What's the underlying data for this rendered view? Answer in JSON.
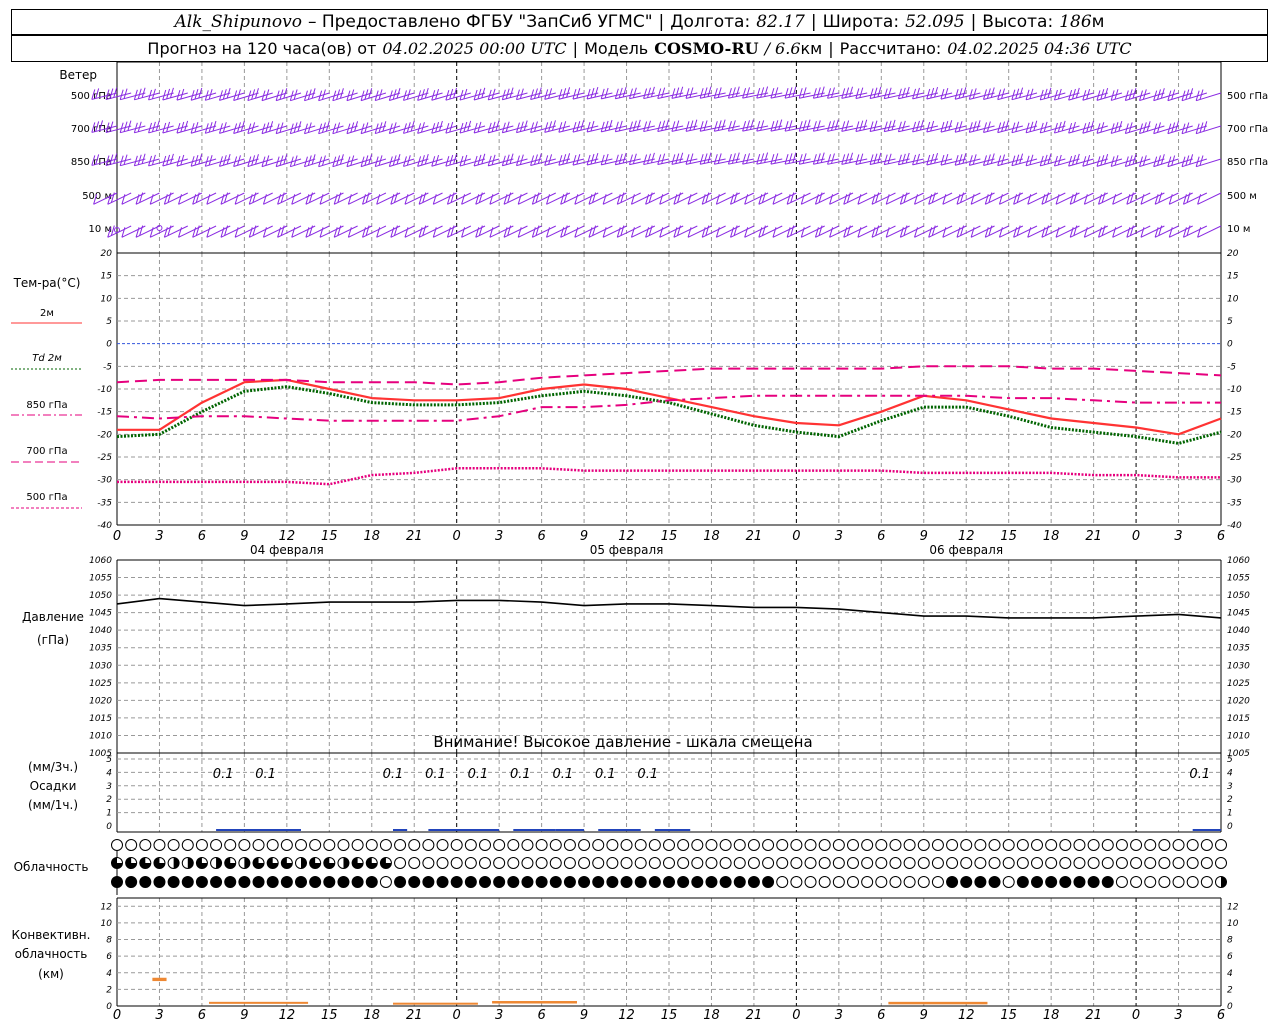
{
  "header": {
    "station": "Alk_Shipunovo",
    "provider": "– Предоставлено ФГБУ \"ЗапСиб УГМС\"",
    "lon_label": "Долгота:",
    "lon_value": "82.17",
    "lat_label": "Широта:",
    "lat_value": "52.095",
    "alt_label": "Высота:",
    "alt_value": "186",
    "alt_unit": "м",
    "sep": "|",
    "forecast_label": "Прогноз на 120 часа(ов) от",
    "forecast_start": "04.02.2025 00:00 UTC",
    "model_label": "Модель",
    "model_name": "COSMO-RU",
    "model_res": "/ 6.6",
    "model_res_unit": "км",
    "calc_label": "Рассчитано:",
    "calc_time": "04.02.2025 04:36 UTC"
  },
  "wind_panel": {
    "title": "Ветер",
    "levels": [
      "500 гПа",
      "700 гПа",
      "850 гПа",
      "500 м",
      "10  м"
    ],
    "color": "#8a2be2"
  },
  "temp_panel": {
    "title": "Тем-ра(°C)",
    "legend": [
      {
        "label": "2м",
        "color": "#ff3333",
        "style": "solid"
      },
      {
        "label": "Td  2м",
        "color": "#006400",
        "style": "dotted"
      },
      {
        "label": "850 гПа",
        "color": "#e6007e",
        "style": "dashdot"
      },
      {
        "label": "700 гПа",
        "color": "#e6007e",
        "style": "dashed"
      },
      {
        "label": "500 гПа",
        "color": "#e6007e",
        "style": "dotted"
      }
    ]
  },
  "pressure_panel": {
    "title": "Давление",
    "unit": "(гПа)",
    "warning": "Внимание! Высокое давление - шкала смещена"
  },
  "precip_panel": {
    "label1": "(мм/3ч.)",
    "label2": "Осадки",
    "label3": "(мм/1ч.)",
    "annotations": [
      "0.1",
      "0.1",
      "0.1",
      "0.1",
      "0.1",
      "0.1",
      "0.1",
      "0.1",
      "0.1",
      "0.1"
    ]
  },
  "cloud_panel": {
    "title": "Облачность"
  },
  "conv_panel": {
    "label1": "Конвективн.",
    "label2": "облачность",
    "label3": "(км)"
  },
  "x_axis": {
    "hour_labels": [
      "0",
      "3",
      "6",
      "9",
      "12",
      "15",
      "18",
      "21",
      "0",
      "3",
      "6",
      "9",
      "12",
      "15",
      "18",
      "21",
      "0",
      "3",
      "6",
      "9",
      "12",
      "15",
      "18",
      "21",
      "0",
      "3",
      "6"
    ],
    "day_labels": [
      "04 февраля",
      "05 февраля",
      "06 февраля"
    ]
  },
  "chart_data": [
    {
      "type": "line",
      "title": "Тем-ра(°C)",
      "x_hours": [
        0,
        3,
        6,
        9,
        12,
        15,
        18,
        21,
        24,
        27,
        30,
        33,
        36,
        39,
        42,
        45,
        48,
        51,
        54,
        57,
        60,
        63,
        66,
        69,
        72,
        75,
        78
      ],
      "ylim": [
        -40,
        20
      ],
      "yticks": [
        20,
        15,
        10,
        5,
        0,
        -5,
        -10,
        -15,
        -20,
        -25,
        -30,
        -35,
        -40
      ],
      "series": [
        {
          "name": "2м",
          "values": [
            -19,
            -19,
            -13,
            -8.5,
            -8,
            -10,
            -12,
            -12.5,
            -12.5,
            -12,
            -10,
            -9,
            -10,
            -12,
            -14,
            -16,
            -17.5,
            -18,
            -15,
            -11.5,
            -12.5,
            -14.5,
            -16.5,
            -17.5,
            -18.5,
            -20,
            -16.5
          ]
        },
        {
          "name": "Td  2м",
          "values": [
            -20.5,
            -20,
            -15,
            -10.5,
            -9.5,
            -11,
            -13,
            -13.5,
            -13.5,
            -13,
            -11.5,
            -10.5,
            -11.5,
            -13,
            -15.5,
            -18,
            -19.5,
            -20.5,
            -17,
            -14,
            -14,
            -16,
            -18.5,
            -19.5,
            -20.5,
            -22,
            -19.5
          ]
        },
        {
          "name": "850 гПа",
          "values": [
            -16,
            -16.5,
            -16,
            -16,
            -16.5,
            -17,
            -17,
            -17,
            -17,
            -16,
            -14,
            -14,
            -13.5,
            -12.5,
            -12,
            -11.5,
            -11.5,
            -11.5,
            -11.5,
            -11.5,
            -11.5,
            -12,
            -12,
            -12.5,
            -13,
            -13,
            -13
          ]
        },
        {
          "name": "700 гПа",
          "values": [
            -8.5,
            -8,
            -8,
            -8,
            -8,
            -8.5,
            -8.5,
            -8.5,
            -9,
            -8.5,
            -7.5,
            -7,
            -6.5,
            -6,
            -5.5,
            -5.5,
            -5.5,
            -5.5,
            -5.5,
            -5,
            -5,
            -5,
            -5.5,
            -5.5,
            -6,
            -6.5,
            -7
          ]
        },
        {
          "name": "500 гПа",
          "values": [
            -30.5,
            -30.5,
            -30.5,
            -30.5,
            -30.5,
            -31,
            -29,
            -28.5,
            -27.5,
            -27.5,
            -27.5,
            -28,
            -28,
            -28,
            -28,
            -28,
            -28,
            -28,
            -28,
            -28.5,
            -28.5,
            -28.5,
            -28.5,
            -29,
            -29,
            -29.5,
            -29.5
          ]
        }
      ]
    },
    {
      "type": "line",
      "title": "Давление",
      "ylim": [
        1005,
        1060
      ],
      "yticks": [
        1060,
        1055,
        1050,
        1045,
        1040,
        1035,
        1030,
        1025,
        1020,
        1015,
        1010,
        1005
      ],
      "x_hours": [
        0,
        3,
        6,
        9,
        12,
        15,
        18,
        21,
        24,
        27,
        30,
        33,
        36,
        39,
        42,
        45,
        48,
        51,
        54,
        57,
        60,
        63,
        66,
        69,
        72,
        75,
        78
      ],
      "series": [
        {
          "name": "pressure",
          "values": [
            1047.5,
            1049,
            1048,
            1047,
            1047.5,
            1048,
            1048,
            1048,
            1048.5,
            1048.5,
            1048,
            1047,
            1047.5,
            1047.5,
            1047,
            1046.5,
            1046.5,
            1046,
            1045,
            1044,
            1044,
            1043.5,
            1043.5,
            1043.5,
            1044,
            1044.5,
            1043.5
          ]
        }
      ]
    },
    {
      "type": "bar",
      "title": "Осадки",
      "ylim": [
        0,
        5
      ],
      "yticks": [
        5,
        4,
        3,
        2,
        1,
        0
      ],
      "annotation_hours": [
        7.5,
        10.5,
        19.5,
        22.5,
        25.5,
        28.5,
        31.5,
        34.5,
        37.5,
        76.5
      ]
    },
    {
      "type": "table",
      "title": "Облачность",
      "row1": "OOOOOOOOOOOOOOOOOOOOOOOOOOOOOOOOOOOOOOOOOOOOOOOOOOOOOOOOOOOOOOOOOOOOOOOOOOOOOOOOOOOOOOOOOOOOOOOOOOOOOOOOOOOHOOOOOOOOOOOOOOOOOOOOOOOOOOOOOOOOOOOOOOOOOOOOOOOOOOOOOOOOOOOOOOOOOOOOOOOOOOOOOOOOOOOOOOOOOOOOOOOOOOOHQ",
      "row2": "QQQQHHQHQHQQQHQQHQQQOOOOOOOOOOOOOOOOOOOOOOOOOOOOOOOOOOOOOOOOOOOOOOOOOOOOOOOOOOOOOOOOOOOOOOOOOOOOOOOO",
      "row3": "FFFFFFFFFFFFFFFFFFFOFFFFFFFFFFFFFFFFFFFFFFFFFFFOOOOOOOOOOOOFFFFOFFFFFFFOOOOOOOHOOOOOOOOOOOFFFFFFFFFFF"
    },
    {
      "type": "bar",
      "title": "Конвективн. облачность",
      "ylim": [
        0,
        13
      ],
      "yticks": [
        12,
        10,
        8,
        6,
        4,
        2,
        0
      ]
    }
  ]
}
